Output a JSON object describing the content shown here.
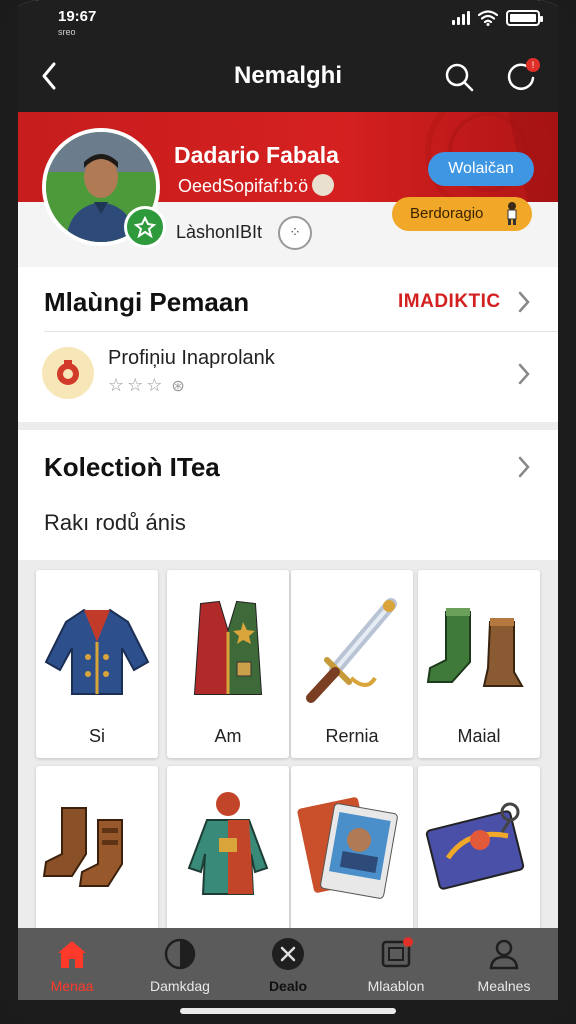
{
  "status": {
    "time": "19:67",
    "sub": "sreo"
  },
  "header": {
    "title": "Nemalghi"
  },
  "profile": {
    "name": "Dadario Fabala",
    "subtitle": "OeedSopifaf:b:ö",
    "label": "LàshonIBIt",
    "blue_pill": "Wolaičan",
    "orange_pill": "Berdoragio",
    "colors": {
      "banner_red": "#d52020",
      "pill_blue": "#3f97e3",
      "pill_orange": "#f1a828",
      "badge_green": "#2e9a3c"
    }
  },
  "card1": {
    "title": "Mlaùngi Pemaan",
    "status": "IMADIKTIC",
    "row_text": "Profiņiu Inaprolank",
    "stars": "☆☆☆"
  },
  "card2": {
    "title": "Kolectioǹ ITea",
    "subtitle": "Rakı rodů ánis"
  },
  "items": [
    {
      "label": "Si",
      "icon": "jacket-icon"
    },
    {
      "label": "Am",
      "icon": "vest-icon"
    },
    {
      "label": "Rernia",
      "icon": "sword-icon"
    },
    {
      "label": "Maial",
      "icon": "boots-icon"
    },
    {
      "label": "",
      "icon": "brown-boots-icon"
    },
    {
      "label": "",
      "icon": "robe-icon"
    },
    {
      "label": "",
      "icon": "player-cards-icon"
    },
    {
      "label": "",
      "icon": "keychain-card-icon"
    }
  ],
  "bottom_nav": [
    {
      "label": "Menaa",
      "icon": "home-icon",
      "active": true
    },
    {
      "label": "Damkdag",
      "icon": "dial-icon",
      "active": false
    },
    {
      "label": "Dealo",
      "icon": "close-circle-icon",
      "active": false
    },
    {
      "label": "Mlaablon",
      "icon": "inbox-icon",
      "active": false
    },
    {
      "label": "Mealnes",
      "icon": "profile-icon",
      "active": false
    }
  ]
}
